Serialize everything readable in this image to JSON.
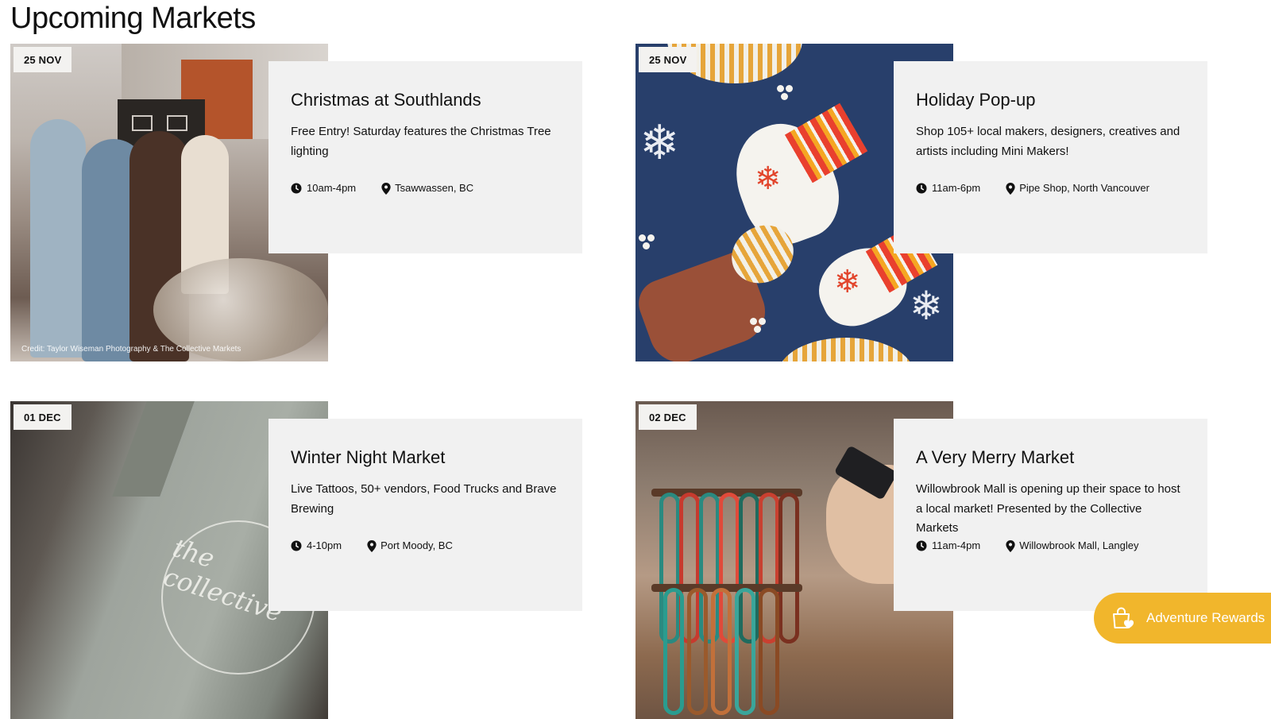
{
  "page": {
    "title": "Upcoming Markets"
  },
  "markets": [
    {
      "date": "25 NOV",
      "title": "Christmas at Southlands",
      "description": "Free Entry! Saturday features the Christmas Tree lighting",
      "time": "10am-4pm",
      "location": "Tsawwassen, BC",
      "credit": "Credit: Taylor Wiseman Photography & The Collective Markets"
    },
    {
      "date": "25 NOV",
      "title": "Holiday Pop-up",
      "description": "Shop 105+ local makers, designers, creatives and artists including Mini Makers!",
      "time": "11am-6pm",
      "location": "Pipe Shop, North Vancouver"
    },
    {
      "date": "01 DEC",
      "title": "Winter Night Market",
      "description": "Live Tattoos, 50+ vendors, Food Trucks and Brave Brewing",
      "time": "4-10pm",
      "location": "Port Moody, BC"
    },
    {
      "date": "02 DEC",
      "title": "A Very Merry Market",
      "description": "Willowbrook Mall is opening up their space to host a local market! Presented by the Collective Markets",
      "time": "11am-4pm",
      "location": "Willowbrook Mall, Langley"
    }
  ],
  "rewards": {
    "label": "Adventure Rewards",
    "icon": "shopping-bag-heart-icon",
    "color": "#f1b62c"
  },
  "icons": {
    "time": "clock-icon",
    "location": "map-pin-icon"
  },
  "colors": {
    "info_panel": "#f1f1f1",
    "badge": "#f3f2f0"
  }
}
